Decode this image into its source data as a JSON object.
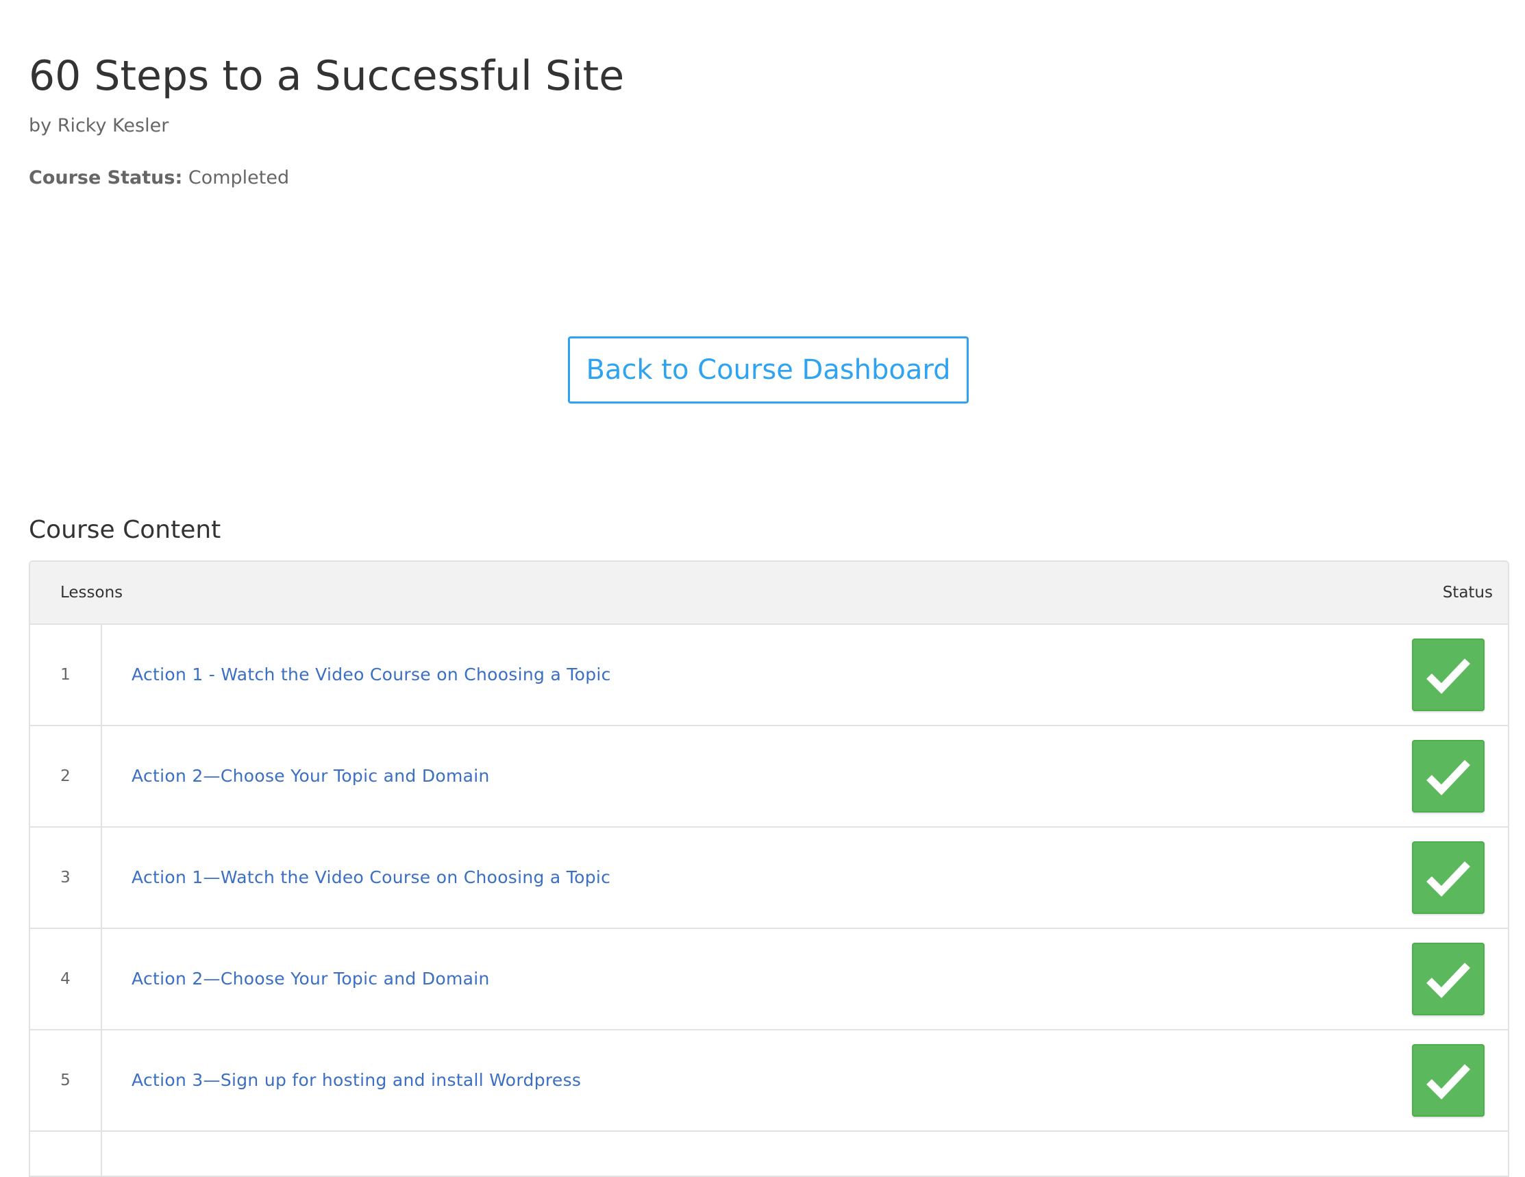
{
  "course": {
    "title": "60 Steps to a Successful Site",
    "author": "by Ricky Kesler",
    "status_label": "Course Status:",
    "status_value": " Completed"
  },
  "actions": {
    "back_button_label": "Back to Course Dashboard"
  },
  "course_content": {
    "heading": "Course Content",
    "columns": {
      "lessons": "Lessons",
      "status": "Status"
    },
    "lessons": [
      {
        "number": "1",
        "title": "Action 1 - Watch the Video Course on Choosing a Topic",
        "completed": true
      },
      {
        "number": "2",
        "title": "Action 2—Choose Your Topic and Domain",
        "completed": true
      },
      {
        "number": "3",
        "title": "Action 1—Watch the Video Course on Choosing a Topic",
        "completed": true
      },
      {
        "number": "4",
        "title": "Action 2—Choose Your Topic and Domain",
        "completed": true
      },
      {
        "number": "5",
        "title": "Action 3—Sign up for hosting and install Wordpress",
        "completed": true
      }
    ]
  },
  "colors": {
    "accent": "#2ea3f2",
    "link": "#3a6fc4",
    "complete_green": "#5cb85c"
  },
  "icons": {
    "status_complete": "checkmark-icon"
  }
}
